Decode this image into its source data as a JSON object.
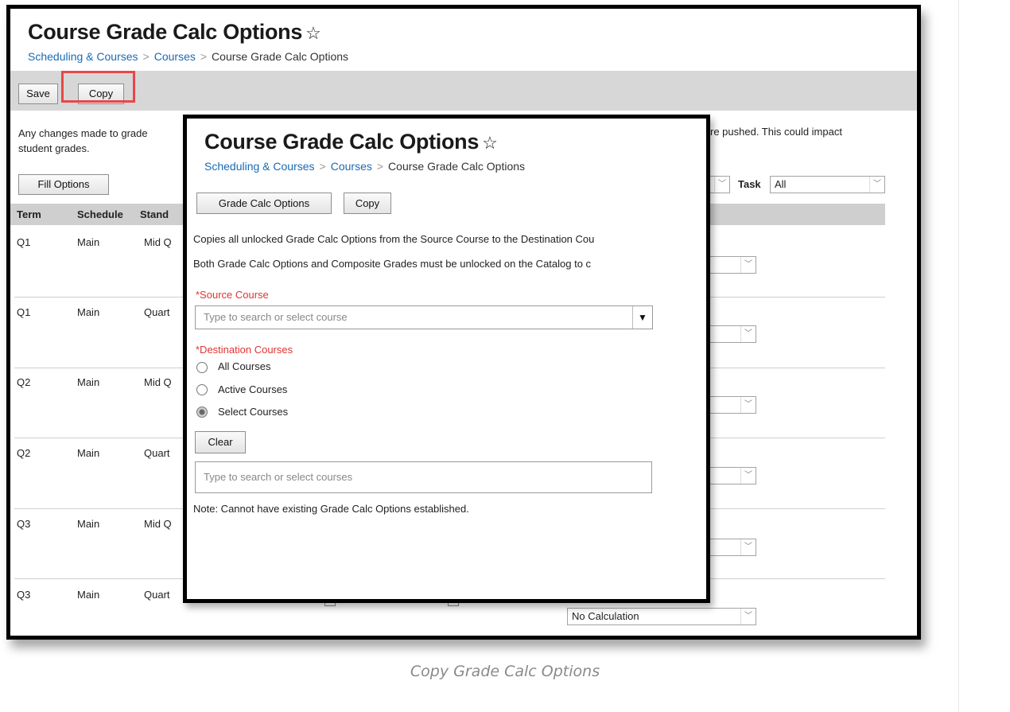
{
  "back": {
    "title": "Course Grade Calc Options",
    "star": "☆",
    "breadcrumb": [
      "Scheduling & Courses",
      "Courses",
      "Course Grade Calc Options"
    ],
    "breadcrumb_sep": ">",
    "toolbar": {
      "save_label": "Save",
      "copy_label": "Copy"
    },
    "notice_line1": "Any changes made to grade",
    "notice_line2": "student grades.",
    "notice_right": "re pushed. This could impact",
    "fill_options_label": "Fill Options",
    "task_label": "Task",
    "task_value": "All",
    "columns": [
      "Term",
      "Schedule",
      "Stand"
    ],
    "rows": [
      {
        "term": "Q1",
        "schedule": "Main",
        "standard": "Mid Q"
      },
      {
        "term": "Q1",
        "schedule": "Main",
        "standard": "Quart"
      },
      {
        "term": "Q2",
        "schedule": "Main",
        "standard": "Mid Q"
      },
      {
        "term": "Q2",
        "schedule": "Main",
        "standard": "Quart"
      },
      {
        "term": "Q3",
        "schedule": "Main",
        "standard": "Mid Q"
      },
      {
        "term": "Q3",
        "schedule": "Main",
        "standard": "Quart"
      }
    ],
    "last_select_value": "No Calculation"
  },
  "front": {
    "title": "Course Grade Calc Options",
    "star": "☆",
    "breadcrumb": [
      "Scheduling & Courses",
      "Courses",
      "Course Grade Calc Options"
    ],
    "breadcrumb_sep": ">",
    "tab_grade_calc": "Grade Calc Options",
    "tab_copy": "Copy",
    "desc1": "Copies all unlocked Grade Calc Options from the Source Course to the Destination Cou",
    "desc2": "Both Grade Calc Options and Composite Grades must be unlocked on the Catalog to c",
    "source_label": "*Source Course",
    "source_placeholder": "Type to search or select course",
    "dest_label": "*Destination Courses",
    "radio_all": "All Courses",
    "radio_active": "Active Courses",
    "radio_select": "Select Courses",
    "selected_option": "Select Courses",
    "clear_label": "Clear",
    "courses_placeholder": "Type to search or select courses",
    "note": "Note: Cannot have existing Grade Calc Options established."
  },
  "caption": "Copy Grade Calc Options",
  "colors": {
    "link": "#1a6ab3",
    "required": "#e23333",
    "highlight": "#e8474a"
  }
}
